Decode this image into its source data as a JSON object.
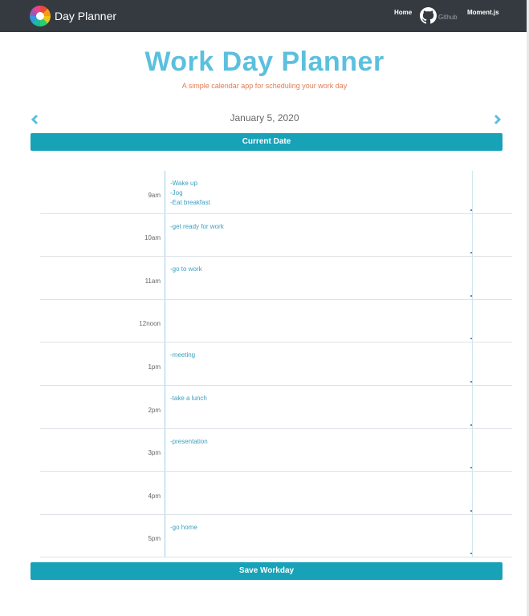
{
  "navbar": {
    "brand": "Day Planner",
    "links": {
      "home": "Home",
      "github": "Github",
      "moment": "Moment.js"
    },
    "icons": {
      "logo": "color-wheel-logo-icon",
      "github": "github-icon"
    }
  },
  "header": {
    "title": "Work Day Planner",
    "subtitle": "A simple calendar app for scheduling your work day"
  },
  "date_nav": {
    "date": "January 5, 2020",
    "prev_icon": "chevron-left-icon",
    "next_icon": "chevron-right-icon",
    "current_button": "Current Date"
  },
  "planner": {
    "rows": [
      {
        "hour": "9am",
        "note": "-Wake up\n-Jog\n-Eat breakfast"
      },
      {
        "hour": "10am",
        "note": "-get ready for work"
      },
      {
        "hour": "11am",
        "note": "-go to work"
      },
      {
        "hour": "12noon",
        "note": ""
      },
      {
        "hour": "1pm",
        "note": "-meeting"
      },
      {
        "hour": "2pm",
        "note": "-take a lunch"
      },
      {
        "hour": "3pm",
        "note": "-presentation"
      },
      {
        "hour": "4pm",
        "note": ""
      },
      {
        "hour": "5pm",
        "note": "-go home"
      }
    ]
  },
  "save_button": "Save Workday",
  "colors": {
    "navbar": "#343a40",
    "title": "#5bc0de",
    "subtitle": "#e07b53",
    "button": "#17a2b8",
    "note_text": "#3a9fbf"
  }
}
